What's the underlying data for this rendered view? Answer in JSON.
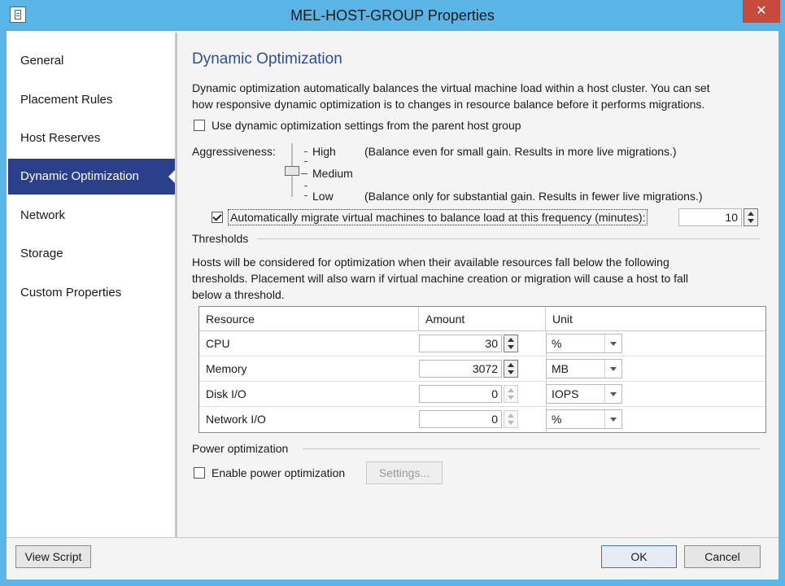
{
  "window": {
    "title": "MEL-HOST-GROUP Properties",
    "close_glyph": "✕"
  },
  "sidebar": {
    "items": [
      {
        "label": "General"
      },
      {
        "label": "Placement Rules"
      },
      {
        "label": "Host Reserves"
      },
      {
        "label": "Dynamic Optimization",
        "active": true
      },
      {
        "label": "Network"
      },
      {
        "label": "Storage"
      },
      {
        "label": "Custom Properties"
      }
    ]
  },
  "main": {
    "heading": "Dynamic Optimization",
    "description_line1": "Dynamic optimization automatically balances the virtual machine load within a host cluster. You can set",
    "description_line2": "how responsive dynamic optimization is to changes in resource balance before it performs migrations.",
    "use_parent_label": "Use dynamic optimization settings from the parent host group",
    "use_parent_checked": false,
    "aggressiveness": {
      "label": "Aggressiveness:",
      "levels": [
        {
          "name": "High",
          "desc": "(Balance even for small gain.  Results in more live migrations.)"
        },
        {
          "name": "Medium",
          "desc": ""
        },
        {
          "name": "Low",
          "desc": "(Balance only for substantial gain.  Results in fewer live migrations.)"
        }
      ],
      "selected": "Medium"
    },
    "auto_migrate": {
      "label": "Automatically migrate virtual machines to balance load at this frequency (minutes):",
      "checked": true,
      "value": "10"
    },
    "thresholds": {
      "title": "Thresholds",
      "desc_line1": "Hosts will be considered for optimization when their available resources fall below the following",
      "desc_line2": "thresholds.  Placement will also warn if virtual machine creation or migration will cause a host to fall",
      "desc_line3": "below a threshold.",
      "columns": [
        "Resource",
        "Amount",
        "Unit"
      ],
      "rows": [
        {
          "resource": "CPU",
          "amount": "30",
          "unit": "%"
        },
        {
          "resource": "Memory",
          "amount": "3072",
          "unit": "MB"
        },
        {
          "resource": "Disk I/O",
          "amount": "0",
          "unit": "IOPS"
        },
        {
          "resource": "Network I/O",
          "amount": "0",
          "unit": "%"
        }
      ]
    },
    "power": {
      "title": "Power optimization",
      "enable_label": "Enable power optimization",
      "enable_checked": false,
      "settings_label": "Settings..."
    }
  },
  "footer": {
    "view_script": "View Script",
    "ok": "OK",
    "cancel": "Cancel"
  },
  "colors": {
    "title_bar": "#5ab4e6",
    "accent": "#2b3f8a",
    "heading": "#2b4f9a",
    "close": "#c74b3d"
  }
}
